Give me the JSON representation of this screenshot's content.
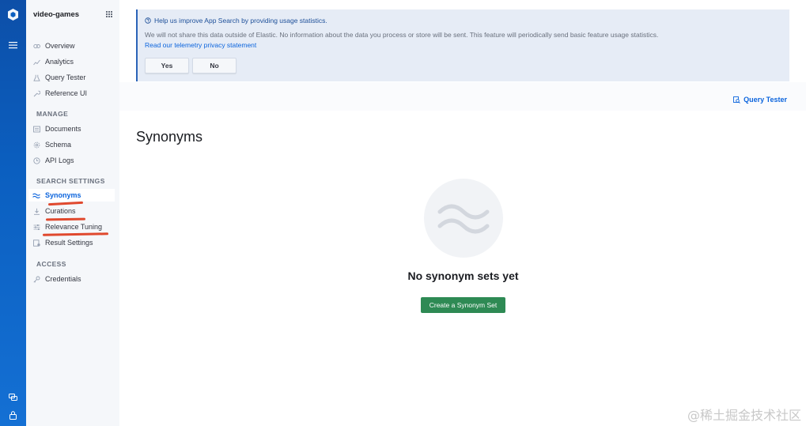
{
  "sidebar": {
    "app_name": "video-games",
    "items_top": [
      {
        "label": "Overview",
        "icon": "overview-icon"
      },
      {
        "label": "Analytics",
        "icon": "analytics-icon"
      },
      {
        "label": "Query Tester",
        "icon": "flask-icon"
      },
      {
        "label": "Reference UI",
        "icon": "wrench-icon"
      }
    ],
    "manage_title": "MANAGE",
    "manage_items": [
      {
        "label": "Documents",
        "icon": "documents-icon"
      },
      {
        "label": "Schema",
        "icon": "gear-icon"
      },
      {
        "label": "API Logs",
        "icon": "clock-icon"
      }
    ],
    "search_title": "SEARCH SETTINGS",
    "search_items": [
      {
        "label": "Synonyms",
        "icon": "synonyms-icon",
        "active": true
      },
      {
        "label": "Curations",
        "icon": "curations-icon"
      },
      {
        "label": "Relevance Tuning",
        "icon": "sliders-icon"
      },
      {
        "label": "Result Settings",
        "icon": "result-settings-icon"
      }
    ],
    "access_title": "ACCESS",
    "access_items": [
      {
        "label": "Credentials",
        "icon": "key-icon"
      }
    ]
  },
  "callout": {
    "title": "Help us improve App Search by providing usage statistics.",
    "body": "We will not share this data outside of Elastic. No information about the data you process or store will be sent. This feature will periodically send basic feature usage statistics.",
    "link": "Read our telemetry privacy statement",
    "yes": "Yes",
    "no": "No"
  },
  "header": {
    "query_tester": "Query Tester"
  },
  "main": {
    "title": "Synonyms",
    "empty_title": "No synonym sets yet",
    "create_button": "Create a Synonym Set"
  },
  "watermark": "@稀土掘金技术社区",
  "colors": {
    "accent": "#0b64dd",
    "rail": "#0b5fc0",
    "success": "#2e8a54",
    "annotation": "#e0492e"
  }
}
